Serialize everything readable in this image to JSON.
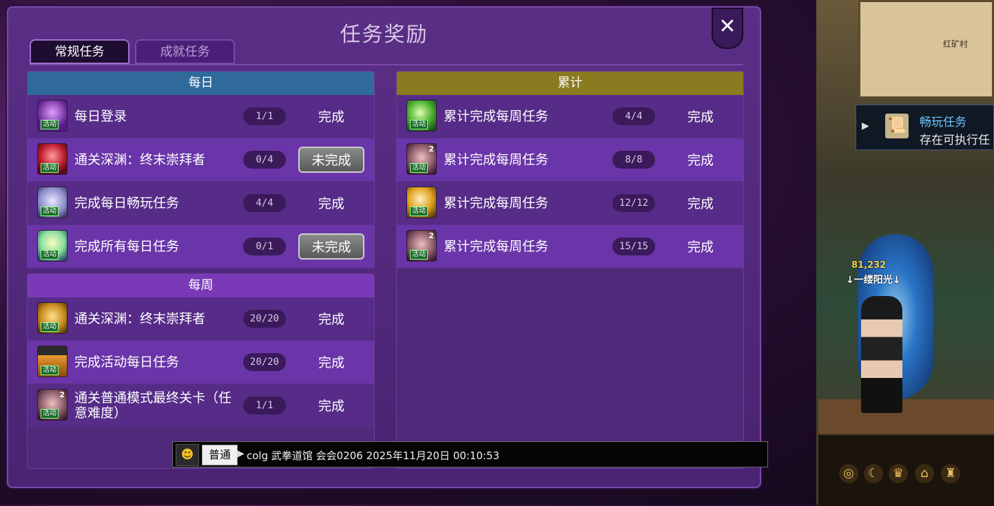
{
  "window": {
    "title": "任务奖励",
    "close_label": "✕"
  },
  "tabs": [
    {
      "label": "常规任务",
      "active": true
    },
    {
      "label": "成就任务",
      "active": false
    }
  ],
  "sections": {
    "daily": {
      "header": "每日",
      "header_color": "#2f6a9a",
      "rows": [
        {
          "name": "每日登录",
          "progress": "1/1",
          "status": "完成",
          "icon": "login-icon",
          "tag": "活动",
          "done": true
        },
        {
          "name": "通关深渊：终末崇拜者",
          "progress": "0/4",
          "status": "未完成",
          "icon": "abyss-icon",
          "tag": "活动",
          "done": false
        },
        {
          "name": "完成每日畅玩任务",
          "progress": "4/4",
          "status": "完成",
          "icon": "gear-icon",
          "tag": "活动",
          "done": true
        },
        {
          "name": "完成所有每日任务",
          "progress": "0/1",
          "status": "未完成",
          "icon": "star-burst-icon",
          "tag": "活动",
          "done": false
        }
      ]
    },
    "weekly": {
      "header": "每周",
      "header_color": "#7a3ab8",
      "rows": [
        {
          "name": "通关深渊：终末崇拜者",
          "progress": "20/20",
          "status": "完成",
          "icon": "gold-abyss-icon",
          "tag": "活动",
          "done": true
        },
        {
          "name": "完成活动每日任务",
          "progress": "20/20",
          "status": "完成",
          "icon": "potion-icon",
          "tag": "活动",
          "done": true
        },
        {
          "name": "通关普通模式最终关卡（任意难度）",
          "progress": "1/1",
          "status": "完成",
          "icon": "boss-icon",
          "tag": "活动",
          "num": "2",
          "done": true
        }
      ]
    },
    "cumulative": {
      "header": "累计",
      "header_color": "#8a7a20",
      "rows": [
        {
          "name": "累计完成每周任务",
          "progress": "4/4",
          "status": "完成",
          "icon": "green-orb-icon",
          "tag": "活动",
          "done": true
        },
        {
          "name": "累计完成每周任务",
          "progress": "8/8",
          "status": "完成",
          "icon": "boss-icon",
          "tag": "活动",
          "num": "2",
          "done": true
        },
        {
          "name": "累计完成每周任务",
          "progress": "12/12",
          "status": "完成",
          "icon": "gold-orb-icon",
          "tag": "活动",
          "done": true
        },
        {
          "name": "累计完成每周任务",
          "progress": "15/15",
          "status": "完成",
          "icon": "boss-icon",
          "tag": "活动",
          "num": "2",
          "done": true
        }
      ]
    }
  },
  "chat": {
    "emoji": "☻",
    "channel": "普通",
    "arrow": "▶",
    "message": "colg 武拳道馆 会会0206 2025年11月20日 00:10:53"
  },
  "side": {
    "minimap_label": "红矿村",
    "quest_title": "畅玩任务",
    "quest_sub": "存在可执行任",
    "char_score": "81,232",
    "char_name": "↓一缕阳光↓"
  },
  "colors": {
    "panel": "#5a2f86",
    "done_text": "#ffffff",
    "todo_button": "#6a6a6a"
  }
}
